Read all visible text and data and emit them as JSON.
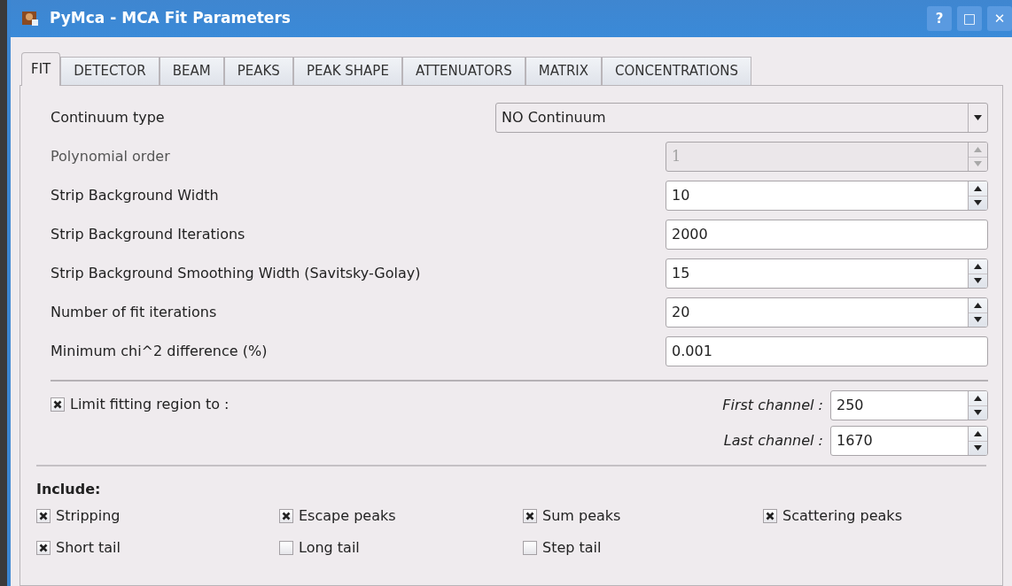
{
  "window": {
    "title": "PyMca - MCA Fit Parameters",
    "buttons": [
      "?",
      "□",
      "✕"
    ]
  },
  "tabs": [
    {
      "label": "FIT",
      "selected": true
    },
    {
      "label": "DETECTOR",
      "selected": false
    },
    {
      "label": "BEAM",
      "selected": false
    },
    {
      "label": "PEAKS",
      "selected": false
    },
    {
      "label": "PEAK SHAPE",
      "selected": false
    },
    {
      "label": "ATTENUATORS",
      "selected": false
    },
    {
      "label": "MATRIX",
      "selected": false
    },
    {
      "label": "CONCENTRATIONS",
      "selected": false
    }
  ],
  "parameters": [
    {
      "label": "Continuum type",
      "kind": "combo",
      "value": "NO Continuum",
      "disabled": false
    },
    {
      "label": "Polynomial order",
      "kind": "spin",
      "value": "1",
      "disabled": true
    },
    {
      "label": "Strip Background Width",
      "kind": "spin",
      "value": "10",
      "disabled": false
    },
    {
      "label": "Strip Background Iterations",
      "kind": "text",
      "value": "2000",
      "disabled": false
    },
    {
      "label": "Strip Background Smoothing Width (Savitsky-Golay)",
      "kind": "spin",
      "value": "15",
      "disabled": false
    },
    {
      "label": "Number of fit iterations",
      "kind": "spin",
      "value": "20",
      "disabled": false
    },
    {
      "label": "Minimum chi^2 difference (%)",
      "kind": "text",
      "value": "0.001",
      "disabled": false
    }
  ],
  "limit_region": {
    "label": "Limit fitting region to :",
    "checked": true,
    "channels": [
      {
        "label": "First channel :",
        "value": "250"
      },
      {
        "label": "Last channel :",
        "value": "1670"
      }
    ]
  },
  "include": {
    "title": "Include:",
    "options": [
      {
        "label": "Stripping",
        "checked": true
      },
      {
        "label": "Escape peaks",
        "checked": true
      },
      {
        "label": "Sum peaks",
        "checked": true
      },
      {
        "label": "Scattering peaks",
        "checked": true
      },
      {
        "label": "Short tail",
        "checked": true
      },
      {
        "label": "Long tail",
        "checked": false
      },
      {
        "label": "Step tail",
        "checked": false
      }
    ]
  }
}
